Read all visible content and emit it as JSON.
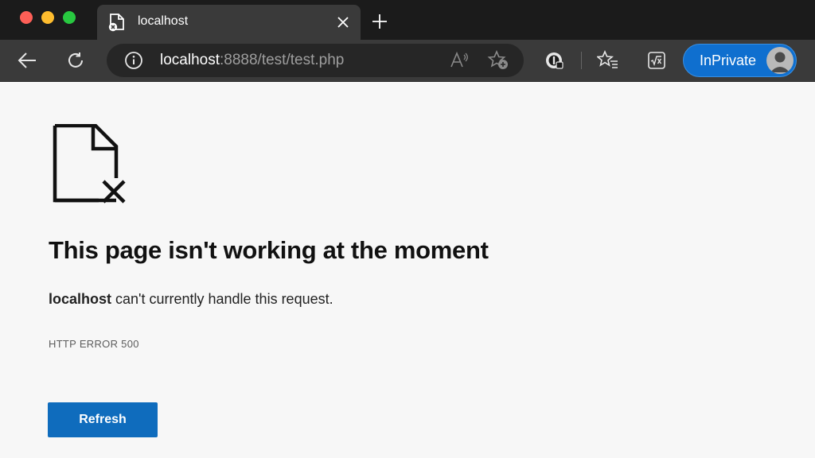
{
  "tab": {
    "title": "localhost",
    "favicon_icon": "broken-page-icon"
  },
  "address_bar": {
    "host": "localhost",
    "path": ":8888/test/test.php"
  },
  "toolbar": {
    "inprivate_label": "InPrivate"
  },
  "error": {
    "heading": "This page isn't working at the moment",
    "host": "localhost",
    "message": " can't currently handle this request.",
    "code": "HTTP ERROR 500",
    "refresh_label": "Refresh"
  },
  "colors": {
    "accent": "#0f6cbd",
    "inprivate": "#0f6fcf",
    "chrome_dark": "#1b1b1b",
    "toolbar": "#3a3a3a"
  }
}
